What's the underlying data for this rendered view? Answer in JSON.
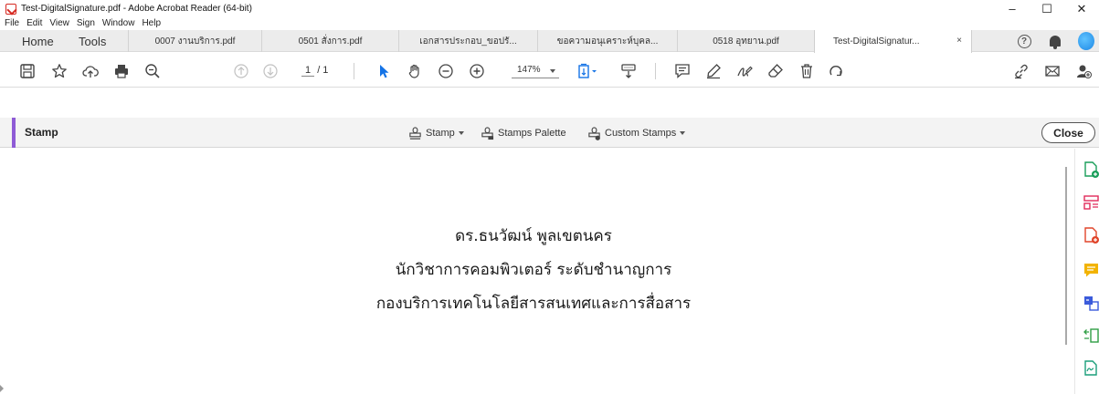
{
  "window": {
    "title": "Test-DigitalSignature.pdf - Adobe Acrobat Reader (64-bit)",
    "controls": [
      "–",
      "☐",
      "✕"
    ]
  },
  "menu": [
    "File",
    "Edit",
    "View",
    "Sign",
    "Window",
    "Help"
  ],
  "tabs": {
    "home": "Home",
    "tools": "Tools",
    "documents": [
      "0007 งานบริการ.pdf",
      "0501 สั่งการ.pdf",
      "เอกสารประกอบ_ขอปรั...",
      "ขอความอนุเคราะห์บุคล...",
      "0518 อุทยาน.pdf",
      "Test-DigitalSignatur..."
    ],
    "active_close": "×",
    "help_glyph": "?"
  },
  "toolbar": {
    "page_current": "1",
    "page_total": "/ 1",
    "zoom": "147%"
  },
  "stamp_bar": {
    "title": "Stamp",
    "stamp_label": "Stamp",
    "palette_label": "Stamps Palette",
    "custom_label": "Custom Stamps",
    "close_label": "Close"
  },
  "document": {
    "lines": [
      "ดร.ธนวัฒน์ พูลเขตนคร",
      "นักวิชาการคอมพิวเตอร์ ระดับชำนาญการ",
      "กองบริการเทคโนโลยีสารสนเทศและการสื่อสาร"
    ]
  },
  "colors": {
    "accent": "#8e5bd6",
    "acrobat_red": "#d62a22",
    "blue_tool": "#1473e6"
  }
}
